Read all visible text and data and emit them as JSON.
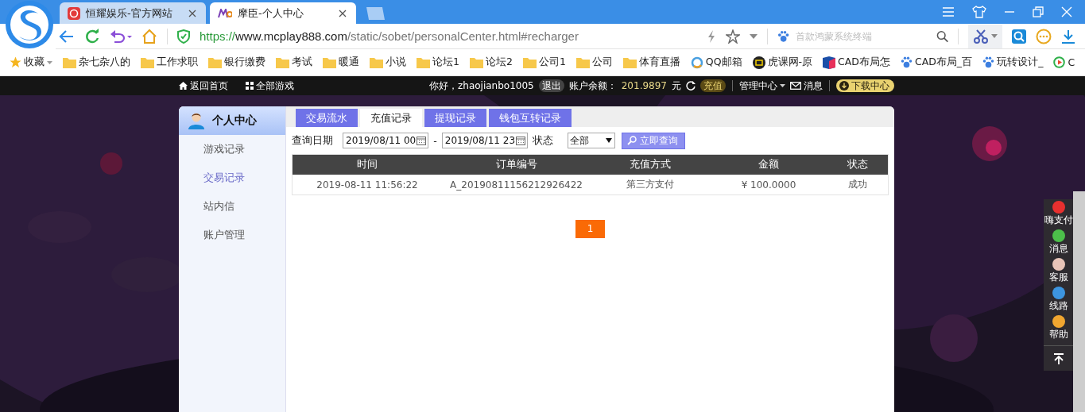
{
  "browser": {
    "tabs": [
      {
        "title": "恒耀娱乐-官方网站",
        "selected": false,
        "kind": "red"
      },
      {
        "title": "摩臣-个人中心",
        "selected": true,
        "kind": "logo"
      }
    ],
    "address": {
      "scheme": "https://",
      "host": "www.mcplay888.com",
      "path": "/static/sobet/personalCenter.html#recharger"
    },
    "search": {
      "placeholder": "首款鸿蒙系统终端"
    },
    "bookmarks": [
      {
        "label": "收藏",
        "kind": "star"
      },
      {
        "label": "杂七杂八的",
        "kind": "folder"
      },
      {
        "label": "工作求职",
        "kind": "folder"
      },
      {
        "label": "银行缴费",
        "kind": "folder"
      },
      {
        "label": "考试",
        "kind": "folder"
      },
      {
        "label": "暖通",
        "kind": "folder"
      },
      {
        "label": "小说",
        "kind": "folder"
      },
      {
        "label": "论坛1",
        "kind": "folder"
      },
      {
        "label": "论坛2",
        "kind": "folder"
      },
      {
        "label": "公司1",
        "kind": "folder"
      },
      {
        "label": "公司",
        "kind": "folder"
      },
      {
        "label": "体育直播",
        "kind": "folder"
      },
      {
        "label": "QQ邮箱",
        "kind": "mail"
      },
      {
        "label": "虎课网-原",
        "kind": "tv"
      },
      {
        "label": "CAD布局怎",
        "kind": "cube"
      },
      {
        "label": "CAD布局_百",
        "kind": "paw"
      },
      {
        "label": "玩转设计_",
        "kind": "paw"
      },
      {
        "label": "C",
        "kind": "play"
      }
    ]
  },
  "site_nav": {
    "home": "返回首页",
    "games": "全部游戏",
    "greeting": "你好，zhaojianbo1005",
    "logout": "退出",
    "balance_label": "账户余额：",
    "balance": "201.9897",
    "unit": "元",
    "recharge": "充值",
    "admin": "管理中心",
    "messages": "消息",
    "download": "下载中心"
  },
  "sidebar": {
    "title": "个人中心",
    "items": [
      {
        "label": "游戏记录",
        "selected": false
      },
      {
        "label": "交易记录",
        "selected": true
      },
      {
        "label": "站内信",
        "selected": false
      },
      {
        "label": "账户管理",
        "selected": false
      }
    ]
  },
  "tabs": [
    {
      "label": "交易流水",
      "selected": false
    },
    {
      "label": "充值记录",
      "selected": true
    },
    {
      "label": "提现记录",
      "selected": false
    },
    {
      "label": "钱包互转记录",
      "selected": false
    }
  ],
  "filter": {
    "date_label": "查询日期",
    "date_from": "2019/08/11 00",
    "separator": "-",
    "date_to": "2019/08/11 23",
    "status_label": "状态",
    "status_value": "全部",
    "query_button": "立即查询"
  },
  "table": {
    "columns": [
      "时间",
      "订单编号",
      "充值方式",
      "金额",
      "状态"
    ],
    "rows": [
      [
        "2019-08-11 11:56:22",
        "A_20190811156212926422",
        "第三方支付",
        "¥ 100.0000",
        "成功"
      ]
    ]
  },
  "pagination": {
    "pages": [
      {
        "label": "1",
        "selected": true
      }
    ]
  },
  "float_menu": {
    "items": [
      {
        "label": "嗨支付",
        "color": "#e8302f"
      },
      {
        "label": "消息",
        "color": "#4cbf4a"
      },
      {
        "label": "客服",
        "color": "#e8c4b8"
      },
      {
        "label": "线路",
        "color": "#3d95e0"
      },
      {
        "label": "帮助",
        "color": "#f0a630"
      }
    ]
  }
}
